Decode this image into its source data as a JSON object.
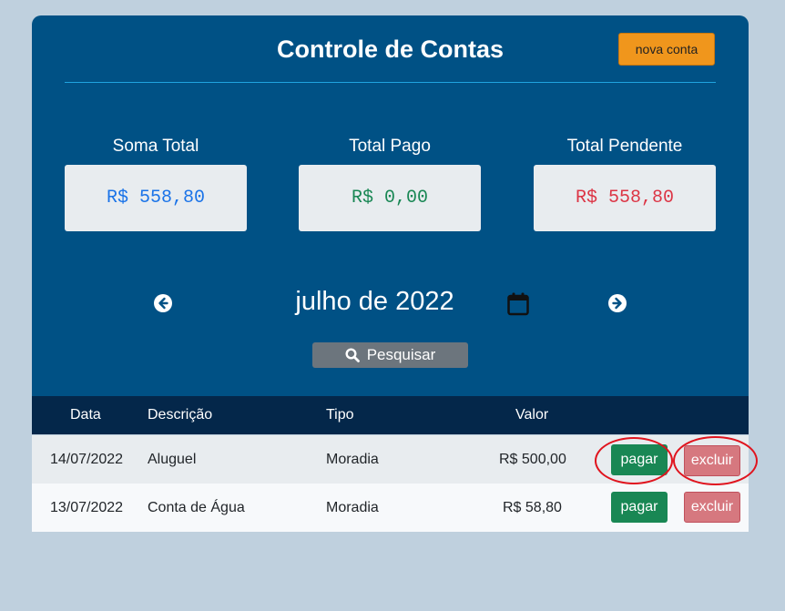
{
  "header": {
    "title": "Controle de Contas",
    "new_button": "nova conta"
  },
  "summary": {
    "total_label": "Soma Total",
    "total_value": "R$ 558,80",
    "paid_label": "Total Pago",
    "paid_value": "R$ 0,00",
    "pending_label": "Total Pendente",
    "pending_value": "R$ 558,80"
  },
  "colors": {
    "background": "#bfd0de",
    "card": "#005185",
    "accent": "#f0961c",
    "total": "#1a73e8",
    "paid": "#198754",
    "pending": "#dc3545"
  },
  "month_nav": {
    "month_label": "julho de 2022",
    "prev_icon": "arrow-left-circle-icon",
    "next_icon": "arrow-right-circle-icon",
    "calendar_icon": "calendar-icon"
  },
  "search": {
    "label": "Pesquisar",
    "icon": "search-icon"
  },
  "table": {
    "headers": [
      "Data",
      "Descrição",
      "Tipo",
      "Valor"
    ],
    "rows": [
      {
        "date": "14/07/2022",
        "description": "Aluguel",
        "type": "Moradia",
        "value": "R$ 500,00",
        "pay": "pagar",
        "delete": "excluir"
      },
      {
        "date": "13/07/2022",
        "description": "Conta de Água",
        "type": "Moradia",
        "value": "R$ 58,80",
        "pay": "pagar",
        "delete": "excluir"
      }
    ]
  }
}
